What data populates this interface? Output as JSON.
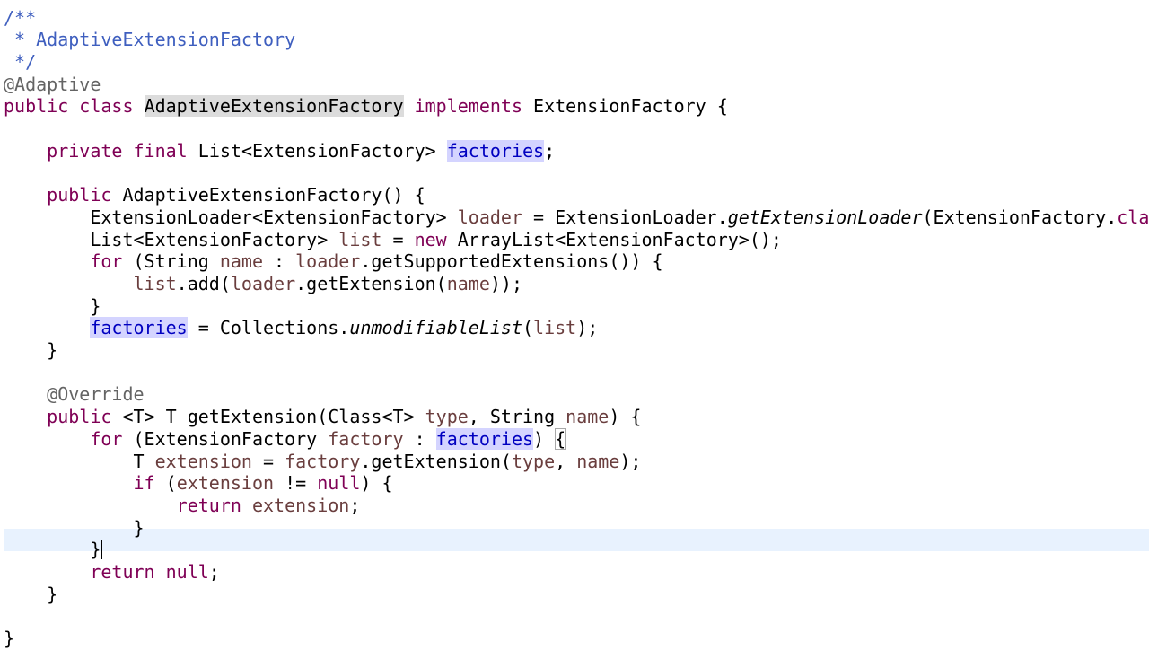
{
  "editor": {
    "language": "java",
    "current_line_index": 24,
    "colors": {
      "keyword": "#7f0055",
      "comment": "#3f5fbf",
      "annotation": "#646464",
      "field": "#0000c0",
      "local_variable": "#6a3e3e",
      "plain": "#000000",
      "occurrence_highlight": "#d4d4ff",
      "selection_highlight": "#dcdcdc",
      "current_line_background": "#e8f2fe"
    },
    "lines": [
      [
        {
          "t": "/**",
          "c": "comment"
        }
      ],
      [
        {
          "t": " * AdaptiveExtensionFactory",
          "c": "comment"
        }
      ],
      [
        {
          "t": " */",
          "c": "comment"
        }
      ],
      [
        {
          "t": "@Adaptive",
          "c": "annot"
        }
      ],
      [
        {
          "t": "public",
          "c": "kw"
        },
        {
          "t": " ",
          "c": "plain"
        },
        {
          "t": "class",
          "c": "kw"
        },
        {
          "t": " ",
          "c": "plain"
        },
        {
          "t": "AdaptiveExtensionFactory",
          "c": "plain",
          "hl": "sel"
        },
        {
          "t": " ",
          "c": "plain"
        },
        {
          "t": "implements",
          "c": "kw"
        },
        {
          "t": " ExtensionFactory {",
          "c": "plain"
        }
      ],
      [],
      [
        {
          "t": "    ",
          "c": "plain"
        },
        {
          "t": "private",
          "c": "kw"
        },
        {
          "t": " ",
          "c": "plain"
        },
        {
          "t": "final",
          "c": "kw"
        },
        {
          "t": " List<ExtensionFactory> ",
          "c": "plain"
        },
        {
          "t": "factories",
          "c": "field",
          "hl": "occ"
        },
        {
          "t": ";",
          "c": "plain"
        }
      ],
      [],
      [
        {
          "t": "    ",
          "c": "plain"
        },
        {
          "t": "public",
          "c": "kw"
        },
        {
          "t": " AdaptiveExtensionFactory() {",
          "c": "plain"
        }
      ],
      [
        {
          "t": "        ExtensionLoader<ExtensionFactory> ",
          "c": "plain"
        },
        {
          "t": "loader",
          "c": "local"
        },
        {
          "t": " = ExtensionLoader.",
          "c": "plain"
        },
        {
          "t": "getExtensionLoader",
          "c": "plain",
          "i": true
        },
        {
          "t": "(ExtensionFactory.",
          "c": "plain"
        },
        {
          "t": "class",
          "c": "kw"
        },
        {
          "t": ");",
          "c": "plain"
        }
      ],
      [
        {
          "t": "        List<ExtensionFactory> ",
          "c": "plain"
        },
        {
          "t": "list",
          "c": "local"
        },
        {
          "t": " = ",
          "c": "plain"
        },
        {
          "t": "new",
          "c": "kw"
        },
        {
          "t": " ArrayList<ExtensionFactory>();",
          "c": "plain"
        }
      ],
      [
        {
          "t": "        ",
          "c": "plain"
        },
        {
          "t": "for",
          "c": "kw"
        },
        {
          "t": " (String ",
          "c": "plain"
        },
        {
          "t": "name",
          "c": "local"
        },
        {
          "t": " : ",
          "c": "plain"
        },
        {
          "t": "loader",
          "c": "local"
        },
        {
          "t": ".getSupportedExtensions()) {",
          "c": "plain"
        }
      ],
      [
        {
          "t": "            ",
          "c": "plain"
        },
        {
          "t": "list",
          "c": "local"
        },
        {
          "t": ".add(",
          "c": "plain"
        },
        {
          "t": "loader",
          "c": "local"
        },
        {
          "t": ".getExtension(",
          "c": "plain"
        },
        {
          "t": "name",
          "c": "local"
        },
        {
          "t": "));",
          "c": "plain"
        }
      ],
      [
        {
          "t": "        }",
          "c": "plain"
        }
      ],
      [
        {
          "t": "        ",
          "c": "plain"
        },
        {
          "t": "factories",
          "c": "field",
          "hl": "occ"
        },
        {
          "t": " = Collections.",
          "c": "plain"
        },
        {
          "t": "unmodifiableList",
          "c": "plain",
          "i": true
        },
        {
          "t": "(",
          "c": "plain"
        },
        {
          "t": "list",
          "c": "local"
        },
        {
          "t": ");",
          "c": "plain"
        }
      ],
      [
        {
          "t": "    }",
          "c": "plain"
        }
      ],
      [],
      [
        {
          "t": "    ",
          "c": "plain"
        },
        {
          "t": "@Override",
          "c": "annot"
        }
      ],
      [
        {
          "t": "    ",
          "c": "plain"
        },
        {
          "t": "public",
          "c": "kw"
        },
        {
          "t": " <T> T getExtension(Class<T> ",
          "c": "plain"
        },
        {
          "t": "type",
          "c": "local"
        },
        {
          "t": ", String ",
          "c": "plain"
        },
        {
          "t": "name",
          "c": "local"
        },
        {
          "t": ") {",
          "c": "plain"
        }
      ],
      [
        {
          "t": "        ",
          "c": "plain"
        },
        {
          "t": "for",
          "c": "kw"
        },
        {
          "t": " (ExtensionFactory ",
          "c": "plain"
        },
        {
          "t": "factory",
          "c": "local"
        },
        {
          "t": " : ",
          "c": "plain"
        },
        {
          "t": "factories",
          "c": "field",
          "hl": "occ"
        },
        {
          "t": ") ",
          "c": "plain"
        },
        {
          "t": "{",
          "c": "plain",
          "box": true
        }
      ],
      [
        {
          "t": "            T ",
          "c": "plain"
        },
        {
          "t": "extension",
          "c": "local"
        },
        {
          "t": " = ",
          "c": "plain"
        },
        {
          "t": "factory",
          "c": "local"
        },
        {
          "t": ".getExtension(",
          "c": "plain"
        },
        {
          "t": "type",
          "c": "local"
        },
        {
          "t": ", ",
          "c": "plain"
        },
        {
          "t": "name",
          "c": "local"
        },
        {
          "t": ");",
          "c": "plain"
        }
      ],
      [
        {
          "t": "            ",
          "c": "plain"
        },
        {
          "t": "if",
          "c": "kw"
        },
        {
          "t": " (",
          "c": "plain"
        },
        {
          "t": "extension",
          "c": "local"
        },
        {
          "t": " != ",
          "c": "plain"
        },
        {
          "t": "null",
          "c": "kw"
        },
        {
          "t": ") {",
          "c": "plain"
        }
      ],
      [
        {
          "t": "                ",
          "c": "plain"
        },
        {
          "t": "return",
          "c": "kw"
        },
        {
          "t": " ",
          "c": "plain"
        },
        {
          "t": "extension",
          "c": "local"
        },
        {
          "t": ";",
          "c": "plain"
        }
      ],
      [
        {
          "t": "            }",
          "c": "plain"
        }
      ],
      [
        {
          "t": "        }",
          "c": "plain",
          "caret": true
        }
      ],
      [
        {
          "t": "        ",
          "c": "plain"
        },
        {
          "t": "return",
          "c": "kw"
        },
        {
          "t": " ",
          "c": "plain"
        },
        {
          "t": "null",
          "c": "kw"
        },
        {
          "t": ";",
          "c": "plain"
        }
      ],
      [
        {
          "t": "    }",
          "c": "plain"
        }
      ],
      [],
      [
        {
          "t": "}",
          "c": "plain"
        }
      ]
    ]
  }
}
